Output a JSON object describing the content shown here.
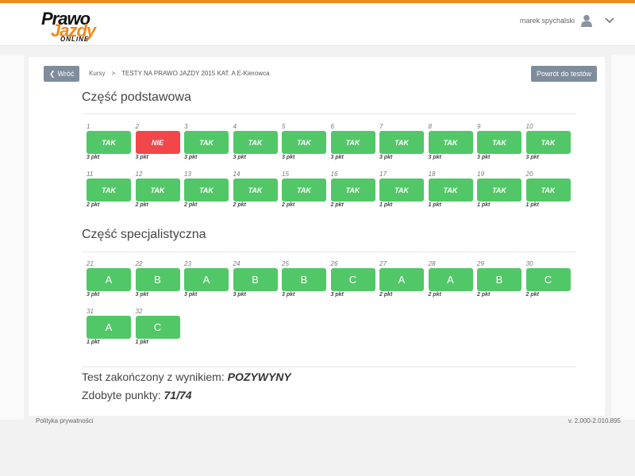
{
  "brand": {
    "line1": "Prawo",
    "line2": "Jazdy",
    "line3": "ONLINE"
  },
  "user": {
    "name": "marek spychalski"
  },
  "nav": {
    "back_label": "Wróć",
    "breadcrumb": [
      "Kursy",
      "TESTY NA PRAWO JAZDY 2015 KAT. A E-Kierowca"
    ],
    "breadcrumb_separator": ">",
    "return_label": "Powrót do testów"
  },
  "basic": {
    "title": "Część podstawowa",
    "questions": [
      {
        "num": "1",
        "answer": "TAK",
        "points": "3 pkt",
        "correct": true
      },
      {
        "num": "2",
        "answer": "NIE",
        "points": "3 pkt",
        "correct": false
      },
      {
        "num": "3",
        "answer": "TAK",
        "points": "3 pkt",
        "correct": true
      },
      {
        "num": "4",
        "answer": "TAK",
        "points": "3 pkt",
        "correct": true
      },
      {
        "num": "5",
        "answer": "TAK",
        "points": "3 pkt",
        "correct": true
      },
      {
        "num": "6",
        "answer": "TAK",
        "points": "3 pkt",
        "correct": true
      },
      {
        "num": "7",
        "answer": "TAK",
        "points": "3 pkt",
        "correct": true
      },
      {
        "num": "8",
        "answer": "TAK",
        "points": "3 pkt",
        "correct": true
      },
      {
        "num": "9",
        "answer": "TAK",
        "points": "3 pkt",
        "correct": true
      },
      {
        "num": "10",
        "answer": "TAK",
        "points": "3 pkt",
        "correct": true
      },
      {
        "num": "11",
        "answer": "TAK",
        "points": "2 pkt",
        "correct": true
      },
      {
        "num": "12",
        "answer": "TAK",
        "points": "2 pkt",
        "correct": true
      },
      {
        "num": "13",
        "answer": "TAK",
        "points": "2 pkt",
        "correct": true
      },
      {
        "num": "14",
        "answer": "TAK",
        "points": "2 pkt",
        "correct": true
      },
      {
        "num": "15",
        "answer": "TAK",
        "points": "2 pkt",
        "correct": true
      },
      {
        "num": "16",
        "answer": "TAK",
        "points": "2 pkt",
        "correct": true
      },
      {
        "num": "17",
        "answer": "TAK",
        "points": "1 pkt",
        "correct": true
      },
      {
        "num": "18",
        "answer": "TAK",
        "points": "1 pkt",
        "correct": true
      },
      {
        "num": "19",
        "answer": "TAK",
        "points": "1 pkt",
        "correct": true
      },
      {
        "num": "20",
        "answer": "TAK",
        "points": "1 pkt",
        "correct": true
      }
    ]
  },
  "specialist": {
    "title": "Część specjalistyczna",
    "questions": [
      {
        "num": "21",
        "answer": "A",
        "points": "3 pkt",
        "correct": true
      },
      {
        "num": "22",
        "answer": "B",
        "points": "3 pkt",
        "correct": true
      },
      {
        "num": "23",
        "answer": "A",
        "points": "3 pkt",
        "correct": true
      },
      {
        "num": "24",
        "answer": "B",
        "points": "3 pkt",
        "correct": true
      },
      {
        "num": "25",
        "answer": "B",
        "points": "3 pkt",
        "correct": true
      },
      {
        "num": "26",
        "answer": "C",
        "points": "3 pkt",
        "correct": true
      },
      {
        "num": "27",
        "answer": "A",
        "points": "2 pkt",
        "correct": true
      },
      {
        "num": "28",
        "answer": "A",
        "points": "2 pkt",
        "correct": true
      },
      {
        "num": "29",
        "answer": "B",
        "points": "2 pkt",
        "correct": true
      },
      {
        "num": "30",
        "answer": "C",
        "points": "2 pkt",
        "correct": true
      },
      {
        "num": "31",
        "answer": "A",
        "points": "1 pkt",
        "correct": true
      },
      {
        "num": "32",
        "answer": "C",
        "points": "1 pkt",
        "correct": true
      }
    ]
  },
  "result": {
    "label": "Test zakończony z wynikiem:",
    "value": "POZYWYNY",
    "points_label": "Zdobyte punkty:",
    "points_value": "71/74"
  },
  "footer": {
    "privacy": "Polityka prywatności",
    "version": "v. 2.000-2.010.895"
  },
  "colors": {
    "accent": "#f08a1c",
    "correct": "#52c768",
    "wrong": "#f2474a",
    "button": "#7e8c9c"
  }
}
